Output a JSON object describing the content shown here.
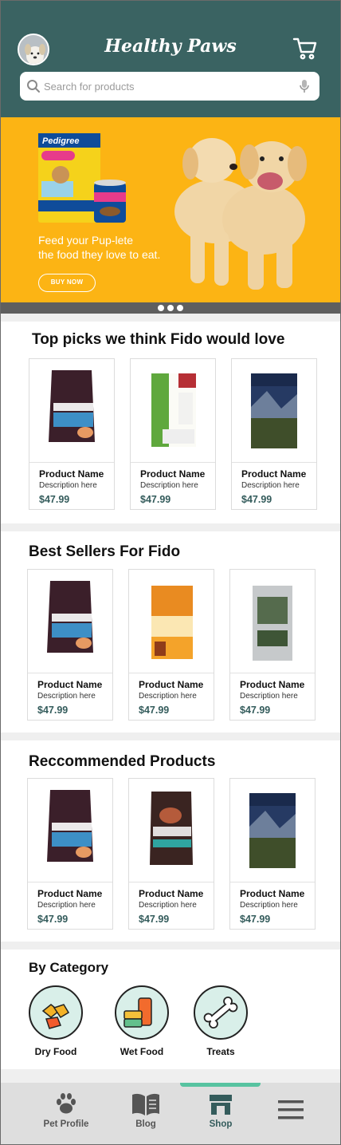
{
  "header": {
    "title": "Healthy Paws",
    "search_placeholder": "Search for products"
  },
  "banner": {
    "tagline_line1": "Feed your Pup-lete",
    "tagline_line2": "the food they love to eat.",
    "cta": "BUY NOW",
    "slides": 3
  },
  "sections": [
    {
      "title": "Top picks we think Fido would love",
      "products": [
        {
          "name": "Product Name",
          "desc": "Description here",
          "price": "$47.99",
          "image": "pristine-bag"
        },
        {
          "name": "Product Name",
          "desc": "Description here",
          "price": "$47.99",
          "image": "organic-chicken-bag"
        },
        {
          "name": "Product Name",
          "desc": "Description here",
          "price": "$47.99",
          "image": "victor-bag"
        }
      ]
    },
    {
      "title": "Best Sellers For Fido",
      "products": [
        {
          "name": "Product Name",
          "desc": "Description here",
          "price": "$47.99",
          "image": "pristine-bag"
        },
        {
          "name": "Product Name",
          "desc": "Description here",
          "price": "$47.99",
          "image": "gather-bag"
        },
        {
          "name": "Product Name",
          "desc": "Description here",
          "price": "$47.99",
          "image": "silver-bag"
        }
      ]
    },
    {
      "title": "Reccommended Products",
      "products": [
        {
          "name": "Product Name",
          "desc": "Description here",
          "price": "$47.99",
          "image": "pristine-bag"
        },
        {
          "name": "Product Name",
          "desc": "Description here",
          "price": "$47.99",
          "image": "organix-bag"
        },
        {
          "name": "Product Name",
          "desc": "Description here",
          "price": "$47.99",
          "image": "victor-bag"
        }
      ]
    }
  ],
  "category": {
    "title": "By Category",
    "items": [
      {
        "label": "Dry Food",
        "icon": "kibble-icon"
      },
      {
        "label": "Wet Food",
        "icon": "can-icon"
      },
      {
        "label": "Treats",
        "icon": "bone-icon"
      }
    ]
  },
  "nav": {
    "items": [
      {
        "label": "Pet Profile",
        "icon": "paw-icon"
      },
      {
        "label": "Blog",
        "icon": "book-icon"
      },
      {
        "label": "Shop",
        "icon": "store-icon"
      },
      {
        "label": "",
        "icon": "menu-icon"
      }
    ],
    "active": "Shop"
  },
  "colors": {
    "header": "#3a6362",
    "banner": "#fcb414",
    "price": "#345c5c",
    "accent": "#57c3a0"
  }
}
